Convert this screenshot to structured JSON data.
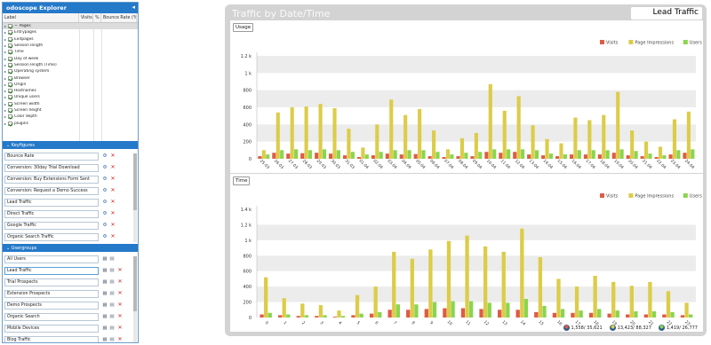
{
  "explorer": {
    "title": "odoscope Explorer",
    "columns": [
      "Label",
      "Visits",
      "%",
      "Bounce Rate (%)"
    ],
    "rows": [
      {
        "label": "Pages",
        "expand": "−",
        "selected": true
      },
      {
        "label": "Entrypages"
      },
      {
        "label": "Exitpages"
      },
      {
        "label": "Session length"
      },
      {
        "label": "Time"
      },
      {
        "label": "Day of week"
      },
      {
        "label": "Session length (Time)"
      },
      {
        "label": "Operating system"
      },
      {
        "label": "Browser"
      },
      {
        "label": "Origin"
      },
      {
        "label": "Hostnames"
      },
      {
        "label": "Unique users"
      },
      {
        "label": "Screen width"
      },
      {
        "label": "Screen height"
      },
      {
        "label": "Color depth"
      },
      {
        "label": "plugins"
      }
    ]
  },
  "keyfigures": {
    "title": "Keyfigures",
    "items": [
      "Bounce Rate",
      "Conversion: 30day Trial Download",
      "Conversion: Buy Extensions Form Sent",
      "Conversion: Request a Demo Success",
      "Lead Traffic",
      "Direct Traffic",
      "Google Traffic",
      "Organic Search Traffic"
    ]
  },
  "usergroups": {
    "title": "Usergroups",
    "items": [
      "All Users",
      "Lead Traffic",
      "Trial Prospects",
      "Extension Prospects",
      "Demo Prospects",
      "Organic Search",
      "Mobile Devices",
      "Blog Traffic"
    ],
    "active_index": 1
  },
  "main": {
    "title": "Traffic by Date/Time",
    "badge": "Lead Traffic"
  },
  "colors": {
    "visits": "#dd5c45",
    "page_impressions": "#dccc48",
    "users": "#8ad54e"
  },
  "chart_data": [
    {
      "type": "bar",
      "tab": "Usage",
      "legend_position": "top-right",
      "grid": true,
      "categories": [
        "25.03",
        "26.03",
        "27.03",
        "28.03",
        "29.03",
        "30.03",
        "31.03",
        "01.04",
        "02.04",
        "03.04",
        "04.04",
        "05.04",
        "06.04",
        "07.04",
        "08.04",
        "09.04",
        "10.04",
        "11.04",
        "12.04",
        "13.04",
        "14.04",
        "15.04",
        "16.04",
        "17.04",
        "18.04",
        "19.04",
        "20.04",
        "21.04",
        "22.04",
        "23.04",
        "24.04"
      ],
      "y_ticks": [
        "0",
        "200",
        "400",
        "600",
        "800",
        "1 k",
        "1.2 k"
      ],
      "ylim": [
        0,
        1200
      ],
      "series": [
        {
          "name": "Visits",
          "values": [
            30,
            70,
            60,
            65,
            70,
            60,
            40,
            20,
            40,
            60,
            50,
            55,
            30,
            20,
            30,
            30,
            80,
            70,
            80,
            50,
            40,
            30,
            50,
            50,
            50,
            70,
            40,
            30,
            20,
            50,
            70
          ]
        },
        {
          "name": "Page Impressions",
          "values": [
            100,
            540,
            600,
            610,
            640,
            590,
            350,
            130,
            400,
            690,
            510,
            580,
            330,
            110,
            240,
            300,
            870,
            560,
            730,
            390,
            230,
            180,
            480,
            450,
            510,
            780,
            330,
            200,
            140,
            460,
            550
          ]
        },
        {
          "name": "Users",
          "values": [
            50,
            100,
            110,
            100,
            110,
            100,
            80,
            50,
            80,
            100,
            100,
            100,
            80,
            50,
            70,
            80,
            110,
            110,
            110,
            100,
            60,
            50,
            100,
            100,
            100,
            110,
            90,
            60,
            40,
            100,
            110
          ]
        }
      ]
    },
    {
      "type": "bar",
      "tab": "Time",
      "legend_position": "top-right",
      "grid": true,
      "categories": [
        "0",
        "1",
        "2",
        "3",
        "4",
        "5",
        "6",
        "7",
        "8",
        "9",
        "10",
        "11",
        "12",
        "13",
        "14",
        "15",
        "16",
        "17",
        "18",
        "19",
        "20",
        "21",
        "22",
        "23"
      ],
      "y_ticks": [
        "0",
        "200",
        "400",
        "600",
        "800",
        "1 k",
        "1.2 k",
        "1.4 k"
      ],
      "ylim": [
        0,
        1400
      ],
      "series": [
        {
          "name": "Visits",
          "values": [
            40,
            30,
            20,
            20,
            10,
            30,
            50,
            100,
            100,
            110,
            120,
            120,
            110,
            100,
            100,
            70,
            60,
            60,
            60,
            50,
            40,
            40,
            40,
            30
          ]
        },
        {
          "name": "Page Impressions",
          "values": [
            520,
            250,
            180,
            160,
            90,
            290,
            400,
            850,
            760,
            880,
            990,
            1060,
            920,
            850,
            1150,
            780,
            500,
            400,
            540,
            460,
            410,
            460,
            340,
            190
          ]
        },
        {
          "name": "Users",
          "values": [
            60,
            40,
            30,
            30,
            20,
            50,
            70,
            170,
            170,
            200,
            210,
            210,
            190,
            190,
            240,
            150,
            110,
            90,
            110,
            90,
            80,
            80,
            70,
            40
          ]
        }
      ]
    }
  ],
  "footer": [
    {
      "icon": "visits-icon",
      "text": "1,558/ 35,621"
    },
    {
      "icon": "page-impressions-icon",
      "text": "13,423/ 88,327"
    },
    {
      "icon": "users-icon",
      "text": "1,419/ 26,777"
    }
  ]
}
